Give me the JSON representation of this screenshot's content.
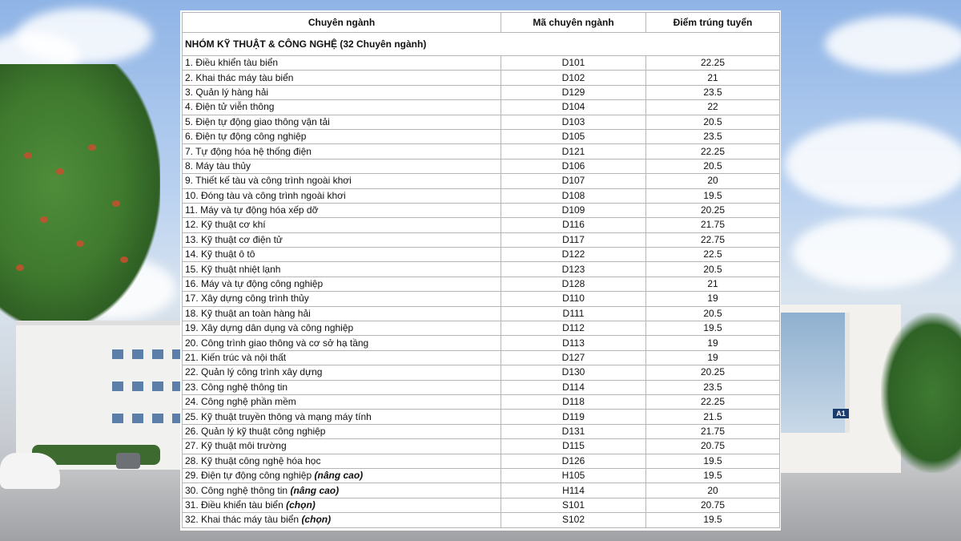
{
  "table": {
    "headers": [
      "Chuyên ngành",
      "Mã chuyên ngành",
      "Điểm trúng tuyển"
    ],
    "group_title": "NHÓM KỸ THUẬT & CÔNG NGHỆ (32 Chuyên ngành)",
    "rows": [
      {
        "name": "1. Điều khiển tàu biển",
        "note": "",
        "code": "D101",
        "score": "22.25"
      },
      {
        "name": "2. Khai thác máy tàu biển",
        "note": "",
        "code": "D102",
        "score": "21"
      },
      {
        "name": "3. Quản lý hàng hải",
        "note": "",
        "code": "D129",
        "score": "23.5"
      },
      {
        "name": "4. Điện tử viễn thông",
        "note": "",
        "code": "D104",
        "score": "22"
      },
      {
        "name": "5. Điện tự động giao thông vận tải",
        "note": "",
        "code": "D103",
        "score": "20.5"
      },
      {
        "name": "6. Điện tự động công nghiệp",
        "note": "",
        "code": "D105",
        "score": "23.5"
      },
      {
        "name": "7. Tự động hóa hệ thống điện",
        "note": "",
        "code": "D121",
        "score": "22.25"
      },
      {
        "name": "8. Máy tàu thủy",
        "note": "",
        "code": "D106",
        "score": "20.5"
      },
      {
        "name": "9. Thiết kế tàu và công trình ngoài khơi",
        "note": "",
        "code": "D107",
        "score": "20"
      },
      {
        "name": "10. Đóng tàu và công trình ngoài khơi",
        "note": "",
        "code": "D108",
        "score": "19.5"
      },
      {
        "name": "11. Máy và tự động hóa xếp dỡ",
        "note": "",
        "code": "D109",
        "score": "20.25"
      },
      {
        "name": "12. Kỹ thuật cơ khí",
        "note": "",
        "code": "D116",
        "score": "21.75"
      },
      {
        "name": "13. Kỹ thuật cơ điện tử",
        "note": "",
        "code": "D117",
        "score": "22.75"
      },
      {
        "name": "14. Kỹ thuật ô tô",
        "note": "",
        "code": "D122",
        "score": "22.5"
      },
      {
        "name": "15. Kỹ thuật nhiệt lạnh",
        "note": "",
        "code": "D123",
        "score": "20.5"
      },
      {
        "name": "16. Máy và tự động công nghiệp",
        "note": "",
        "code": "D128",
        "score": "21"
      },
      {
        "name": "17. Xây dựng công trình thủy",
        "note": "",
        "code": "D110",
        "score": "19"
      },
      {
        "name": "18. Kỹ thuật an toàn hàng hải",
        "note": "",
        "code": "D111",
        "score": "20.5"
      },
      {
        "name": "19. Xây dựng dân dụng và công nghiệp",
        "note": "",
        "code": "D112",
        "score": "19.5"
      },
      {
        "name": "20. Công trình giao thông và cơ sở hạ tầng",
        "note": "",
        "code": "D113",
        "score": "19"
      },
      {
        "name": "21. Kiến trúc và nội thất",
        "note": "",
        "code": "D127",
        "score": "19"
      },
      {
        "name": "22. Quản lý công trình xây dựng",
        "note": "",
        "code": "D130",
        "score": "20.25"
      },
      {
        "name": "23. Công nghệ thông tin",
        "note": "",
        "code": "D114",
        "score": "23.5"
      },
      {
        "name": "24. Công nghệ phần mềm",
        "note": "",
        "code": "D118",
        "score": "22.25"
      },
      {
        "name": "25. Kỹ thuật truyền thông và mạng máy tính",
        "note": "",
        "code": "D119",
        "score": "21.5"
      },
      {
        "name": "26. Quản lý kỹ thuật công nghiệp",
        "note": "",
        "code": "D131",
        "score": "21.75"
      },
      {
        "name": "27. Kỹ thuật môi trường",
        "note": "",
        "code": "D115",
        "score": "20.75"
      },
      {
        "name": "28. Kỹ thuật công nghệ hóa học",
        "note": "",
        "code": "D126",
        "score": "19.5"
      },
      {
        "name": "29. Điện tự động công nghiệp",
        "note": "(nâng cao)",
        "code": "H105",
        "score": "19.5"
      },
      {
        "name": "30. Công nghệ thông tin",
        "note": "(nâng cao)",
        "code": "H114",
        "score": "20"
      },
      {
        "name": "31. Điều khiển tàu biển",
        "note": "(chọn)",
        "code": "S101",
        "score": "20.75"
      },
      {
        "name": "32. Khai thác máy tàu biển",
        "note": "(chọn)",
        "code": "S102",
        "score": "19.5"
      }
    ]
  },
  "background": {
    "building_sign": "A1"
  }
}
